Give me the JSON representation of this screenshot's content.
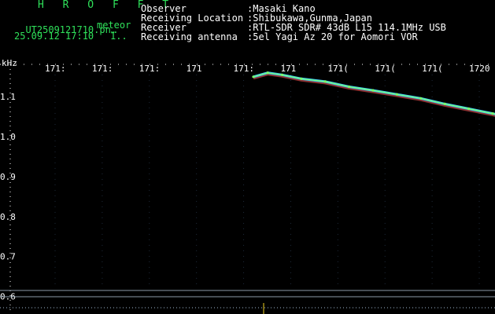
{
  "header": {
    "program": "H R O F F T",
    "filename": "UT2509121710.pn",
    "filename_ellipsis": "…",
    "datetime": "25.09.12 17:10",
    "index": "1..",
    "label_meteor": "meteor",
    "fields": [
      {
        "label": "Observer",
        "value": ":Masaki Kano"
      },
      {
        "label": "Receiving Location",
        "value": ":Shibukawa,Gunma,Japan"
      },
      {
        "label": "Receiver",
        "value": ":RTL-SDR SDR# 43dB L15 114.1MHz USB"
      },
      {
        "label": "Receiving antenna",
        "value": ":5el Yagi Az 20 for Aomori VOR"
      }
    ]
  },
  "chart_data": {
    "type": "scatter",
    "title": "",
    "xlabel": "",
    "ylabel": "kHz",
    "x_ticks": [
      "171:",
      "171:",
      "171:",
      "171",
      "171:",
      "171",
      "171(",
      "171(",
      "171(",
      "1720"
    ],
    "y_ticks": [
      "1.1",
      "1.0",
      "0.9",
      "0.8",
      "0.7",
      "0.6"
    ],
    "ylim": [
      0.595,
      1.185
    ],
    "grid": false,
    "series": [
      {
        "points": [
          {
            "x": 0.5,
            "y": 1.15
          },
          {
            "x": 0.53,
            "y": 1.16
          },
          {
            "x": 0.56,
            "y": 1.155
          },
          {
            "x": 0.6,
            "y": 1.145
          },
          {
            "x": 0.65,
            "y": 1.138
          },
          {
            "x": 0.7,
            "y": 1.125
          },
          {
            "x": 0.75,
            "y": 1.116
          },
          {
            "x": 0.8,
            "y": 1.106
          },
          {
            "x": 0.85,
            "y": 1.096
          },
          {
            "x": 0.9,
            "y": 1.082
          },
          {
            "x": 0.95,
            "y": 1.07
          },
          {
            "x": 1.0,
            "y": 1.058
          },
          {
            "x": 1.05,
            "y": 1.044
          }
        ]
      }
    ]
  },
  "colors": {
    "background": "#000000",
    "header_green": "#2fe05a",
    "trace_cyan": "#3fd0ff",
    "trace_green": "#7dff6a",
    "trace_red": "#ff5a5a",
    "baseline": "#8c9aa8"
  }
}
